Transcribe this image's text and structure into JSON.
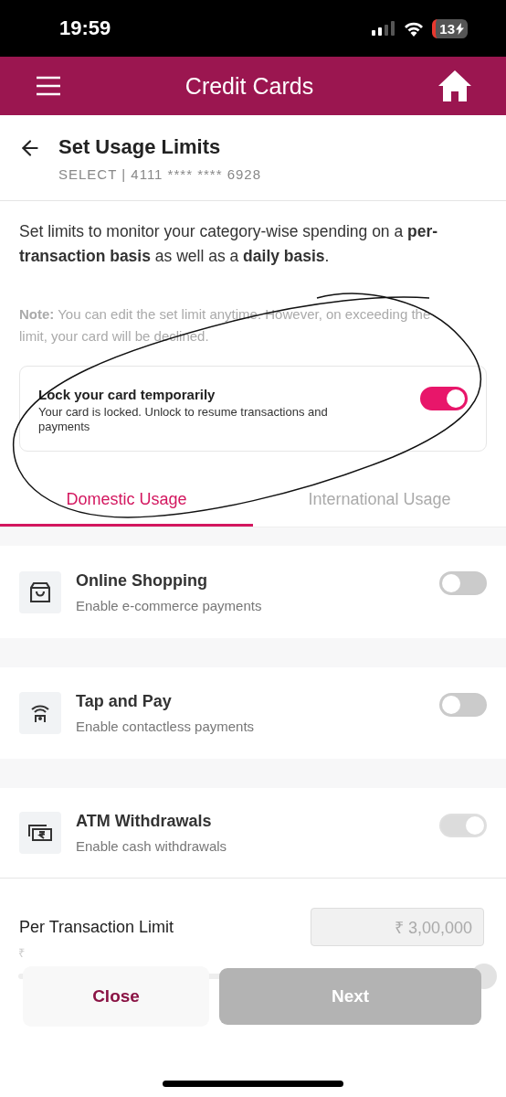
{
  "status_bar": {
    "time": "19:59",
    "battery": "13"
  },
  "header": {
    "title": "Credit Cards"
  },
  "page": {
    "title": "Set Usage Limits",
    "subtitle": "SELECT | 4111 **** **** 6928"
  },
  "intro": "Set limits to monitor your category-wise spending on a **per-transaction basis** as well as a **daily basis**.",
  "note": "**Note:** You can edit the set limit anytime. However, on exceeding the limit, your card will be declined.",
  "lock": {
    "title": "Lock your card temporarily",
    "description": "Your card is locked. Unlock to resume transactions and payments",
    "on": true
  },
  "tabs": [
    {
      "label": "Domestic Usage",
      "selected": true
    },
    {
      "label": "International Usage",
      "selected": false
    }
  ],
  "categories": [
    {
      "kind": "shopping",
      "title": "Online Shopping",
      "subtitle": "Enable e-commerce payments",
      "on": false,
      "disabled": false
    },
    {
      "kind": "contactless",
      "title": "Tap and Pay",
      "subtitle": "Enable contactless payments",
      "on": false,
      "disabled": false
    },
    {
      "kind": "cash",
      "title": "ATM Withdrawals",
      "subtitle": "Enable cash withdrawals",
      "on": true,
      "disabled": true
    }
  ],
  "limit": {
    "label": "Per Transaction Limit",
    "value": "₹ 3,00,000",
    "min_label": "₹",
    "level": 1
  },
  "buttons": {
    "close": "Close",
    "next": "Next",
    "next_disabled": true
  }
}
